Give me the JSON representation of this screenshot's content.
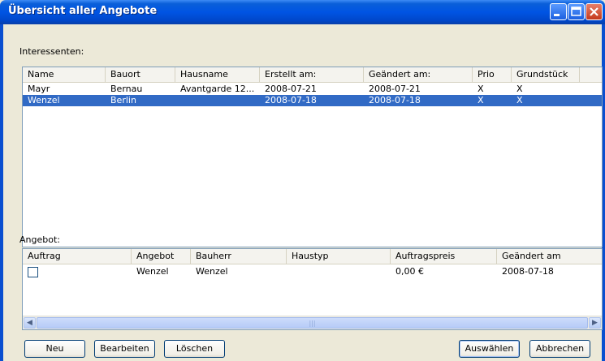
{
  "window": {
    "title": "Übersicht aller Angebote"
  },
  "interessenten": {
    "label": "Interessenten:",
    "columns": [
      "Name",
      "Bauort",
      "Hausname",
      "Erstellt am:",
      "Geändert am:",
      "Prio",
      "Grundstück"
    ],
    "rows": [
      [
        "Mayr",
        "Bernau",
        "Avantgarde 12...",
        "2008-07-21",
        "2008-07-21",
        "X",
        "X"
      ],
      [
        "Wenzel",
        "Berlin",
        "",
        "2008-07-18",
        "2008-07-18",
        "X",
        "X"
      ]
    ],
    "selected_row": 1
  },
  "angebot": {
    "label": "Angebot:",
    "columns": [
      "Auftrag",
      "Angebot",
      "Bauherr",
      "Haustyp",
      "Auftragspreis",
      "Geändert am"
    ],
    "rows": [
      {
        "auftrag_checked": false,
        "angebot": "Wenzel",
        "bauherr": "Wenzel",
        "haustyp": "",
        "auftragspreis": "0,00 €",
        "geaendert": "2008-07-18"
      }
    ]
  },
  "buttons": {
    "neu": "Neu",
    "bearbeiten": "Bearbeiten",
    "loeschen": "Löschen",
    "auswaehlen": "Auswählen",
    "abbrechen": "Abbrechen"
  },
  "icons": [
    "minimize-icon",
    "maximize-icon",
    "close-icon",
    "scroll-left-icon",
    "scroll-right-icon"
  ],
  "colors": {
    "titlebar": "#0054e3",
    "selection": "#316ac5",
    "dialog_bg": "#ece9d8",
    "close_button": "#c4391c"
  }
}
